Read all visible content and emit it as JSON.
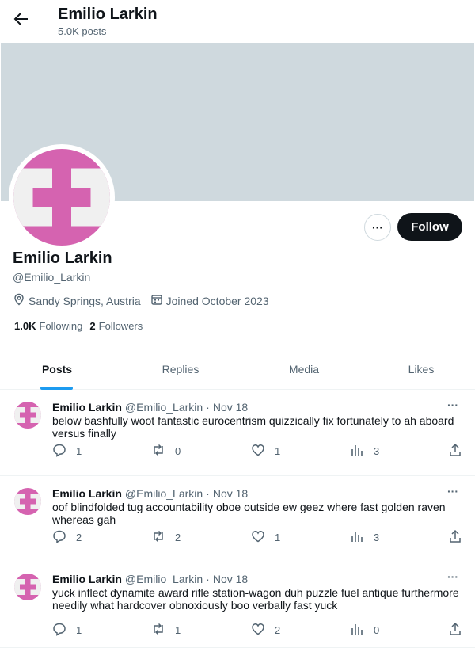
{
  "header": {
    "title": "Emilio Larkin",
    "posts_count": "5.0K posts"
  },
  "profile": {
    "name": "Emilio Larkin",
    "handle": "@Emilio_Larkin",
    "location": "Sandy Springs, Austria",
    "joined": "Joined October 2023",
    "following_count": "1.0K",
    "following_label": "Following",
    "followers_count": "2",
    "followers_label": "Followers",
    "follow_button": "Follow",
    "more_button": "···"
  },
  "colors": {
    "banner": "#cfd9de",
    "avatar_pink": "#d563b0",
    "accent": "#1d9bf0",
    "follow_bg": "#0f1419"
  },
  "tabs": [
    {
      "label": "Posts",
      "active": true
    },
    {
      "label": "Replies",
      "active": false
    },
    {
      "label": "Media",
      "active": false
    },
    {
      "label": "Likes",
      "active": false
    }
  ],
  "posts": [
    {
      "name": "Emilio Larkin",
      "handle": "@Emilio_Larkin",
      "date": "Nov 18",
      "text": "below bashfully woot fantastic eurocentrism quizzically fix fortunately to ah aboard versus finally",
      "replies": "1",
      "reposts": "0",
      "likes": "1",
      "views": "3"
    },
    {
      "name": "Emilio Larkin",
      "handle": "@Emilio_Larkin",
      "date": "Nov 18",
      "text": "oof blindfolded tug accountability oboe outside ew geez where fast golden raven whereas gah",
      "replies": "2",
      "reposts": "2",
      "likes": "1",
      "views": "3"
    },
    {
      "name": "Emilio Larkin",
      "handle": "@Emilio_Larkin",
      "date": "Nov 18",
      "text": "yuck inflect dynamite award rifle station-wagon duh puzzle fuel antique furthermore needily what hardcover obnoxiously boo verbally fast yuck",
      "replies": "1",
      "reposts": "1",
      "likes": "2",
      "views": "0"
    }
  ],
  "icons": {
    "back": "arrow-left-icon",
    "location": "location-pin-icon",
    "calendar": "calendar-icon",
    "reply": "reply-icon",
    "repost": "repost-icon",
    "like": "heart-icon",
    "views": "views-icon",
    "share": "share-icon"
  }
}
